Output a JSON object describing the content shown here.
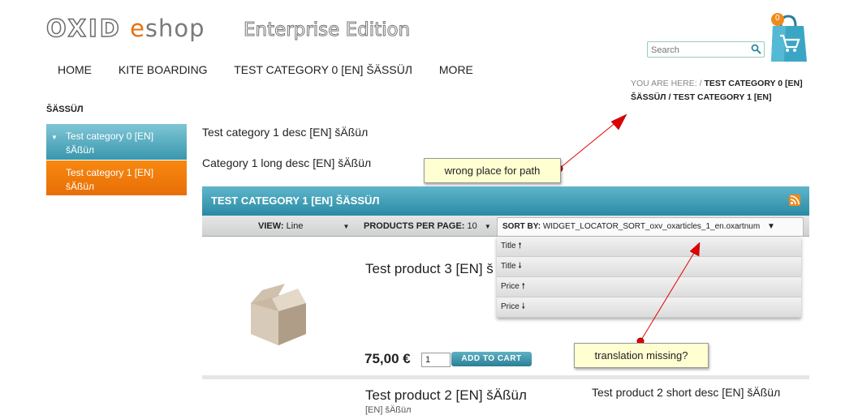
{
  "header": {
    "logo_oxid": "OXID",
    "logo_e": "e",
    "logo_shop": "shop",
    "edition": "Enterprise Edition",
    "cart_count": "0",
    "search_placeholder": "Search"
  },
  "nav": {
    "items": [
      "HOME",
      "KITE BOARDING",
      "TEST CATEGORY 0 [EN] ŠÄSSÜЛ",
      "MORE"
    ]
  },
  "breadcrumb": {
    "prefix": "YOU ARE HERE: /",
    "path": " TEST CATEGORY 0 [EN] ŠÄSSÜЛ / TEST CATEGORY 1 [EN]"
  },
  "sidebar": {
    "title": "ŠÄSSÜЛ",
    "items": [
      {
        "label": "Test category 0 [EN] šÄßüл"
      },
      {
        "label": "Test category 1 [EN] šÄßüл"
      }
    ]
  },
  "category": {
    "description": "Test category 1 desc [EN] šÄßüл",
    "long_description": "Category 1 long desc [EN] šÄßüл",
    "title": "TEST CATEGORY 1 [EN] ŠÄSSÜЛ"
  },
  "toolbar": {
    "view_label": "VIEW:",
    "view_value": "Line",
    "per_page_label": "PRODUCTS PER PAGE:",
    "per_page_value": "10",
    "sort_label": "SORT BY:",
    "sort_value": "WIDGET_LOCATOR_SORT_oxv_oxarticles_1_en.oxartnum"
  },
  "sort_options": [
    {
      "label": "Title",
      "arrow": "🠕"
    },
    {
      "label": "Title",
      "arrow": "🠗"
    },
    {
      "label": "Price",
      "arrow": "🠕"
    },
    {
      "label": "Price",
      "arrow": "🠗"
    }
  ],
  "products": [
    {
      "name": "Test product 3 [EN] š",
      "price": "75,00 €",
      "qty": "1",
      "add_label": "ADD TO CART"
    },
    {
      "name": "Test product 2 [EN] šÄßüл",
      "short_desc": "Test product 2 short desc [EN] šÄßüл",
      "cut_text": "[EN] šÄßüл"
    }
  ],
  "annotations": {
    "note1": "wrong place for path",
    "note2": "translation missing?"
  },
  "colors": {
    "accent": "#2a8aa3",
    "orange": "#e86f08",
    "annotation_arrow": "#e00000"
  }
}
